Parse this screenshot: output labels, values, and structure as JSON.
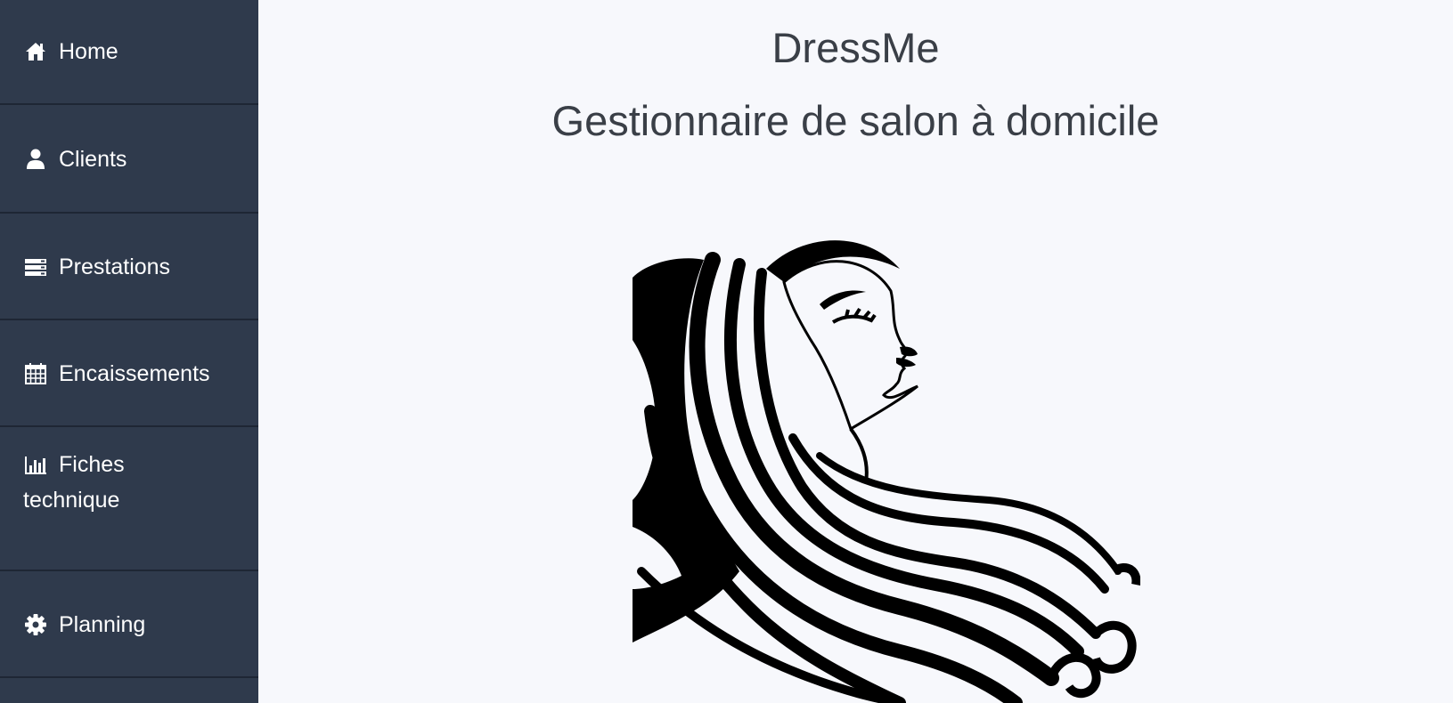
{
  "sidebar": {
    "items": [
      {
        "label": "Home",
        "icon": "home-icon"
      },
      {
        "label": "Clients",
        "icon": "user-icon"
      },
      {
        "label": "Prestations",
        "icon": "server-icon"
      },
      {
        "label": "Encaissements",
        "icon": "calendar-icon"
      },
      {
        "label": "Fiches technique",
        "label_line1": "Fiches",
        "label_line2": "technique",
        "icon": "bar-chart-icon"
      },
      {
        "label": "Planning",
        "icon": "gear-icon"
      }
    ]
  },
  "header": {
    "title": "DressMe",
    "subtitle": "Gestionnaire de salon à domicile"
  },
  "colors": {
    "sidebar_bg": "#2f3a4c",
    "sidebar_divider": "#1e2634",
    "main_bg": "#f7f8fc",
    "text_dark": "#3a3f47"
  }
}
